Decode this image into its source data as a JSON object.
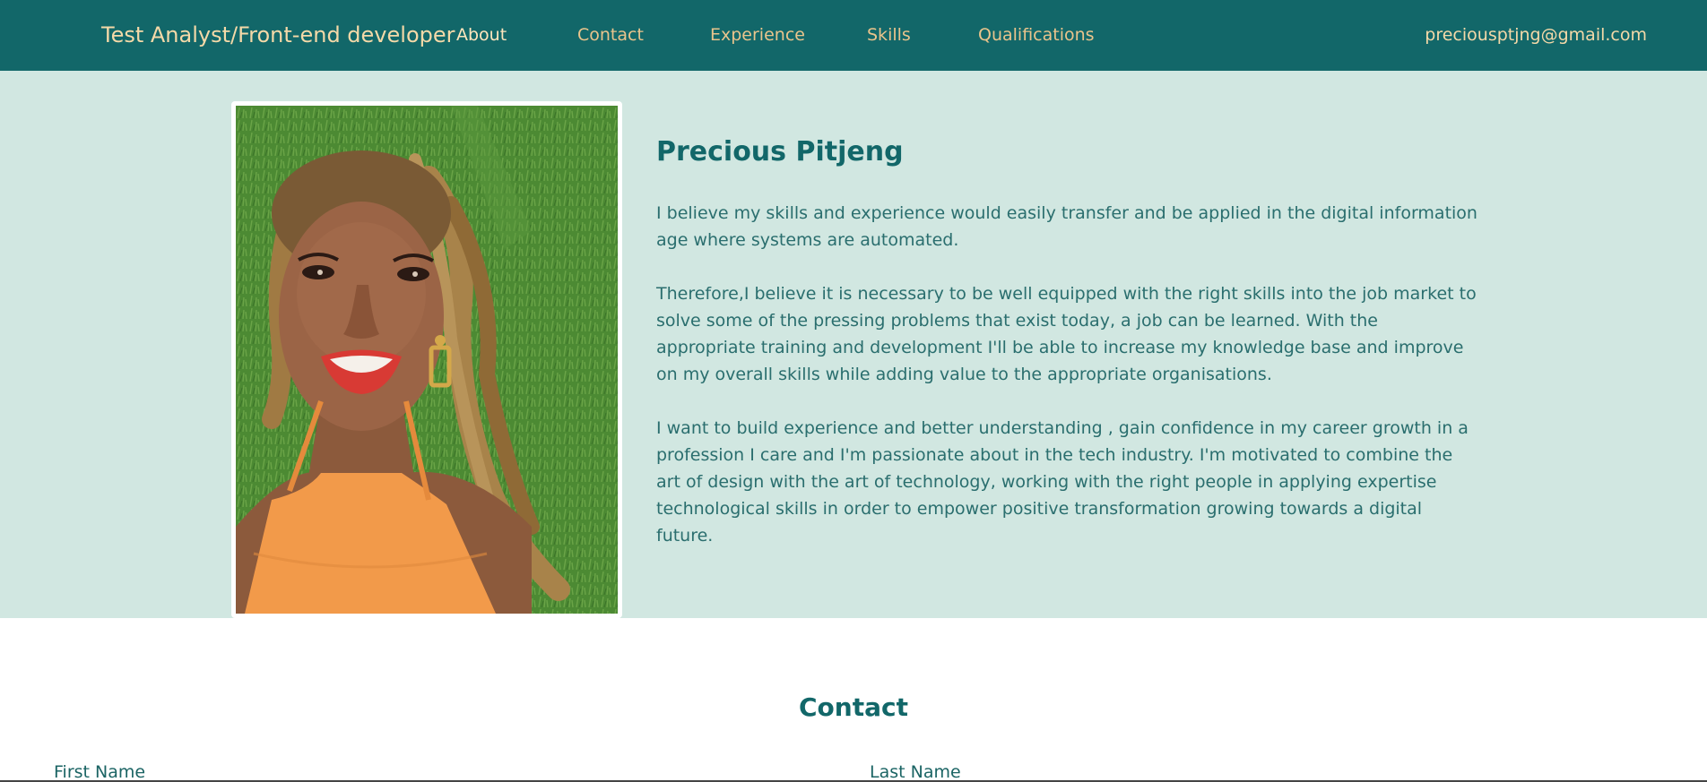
{
  "navbar": {
    "brand": "Test Analyst/Front-end developer",
    "links": [
      "About",
      "Contact",
      "Experience",
      "Skills",
      "Qualifications"
    ],
    "email": "preciousptjng@gmail.com",
    "background": "#126769",
    "link_color": "#e9c48c"
  },
  "about": {
    "name": "Precious Pitjeng",
    "paragraphs": [
      "I believe my skills and experience would easily transfer and be applied in the digital information age where systems are automated.",
      "Therefore,I believe it is necessary to be well equipped with the right skills into the job market to solve some of the pressing problems that exist today, a job can be learned. With the appropriate training and development I'll be able to increase my knowledge base and improve on my overall skills while adding value to the appropriate organisations.",
      "I want to build experience and better understanding , gain confidence in my career growth in a profession I care and I'm passionate about in the tech industry. I'm motivated to combine the art of design with the art of technology, working with the right people in applying expertise technological skills in order to empower positive transformation growing towards a digital future."
    ],
    "background": "#d1e7e1"
  },
  "contact": {
    "title": "Contact",
    "first_name_label": "First Name",
    "last_name_label": "Last Name"
  }
}
